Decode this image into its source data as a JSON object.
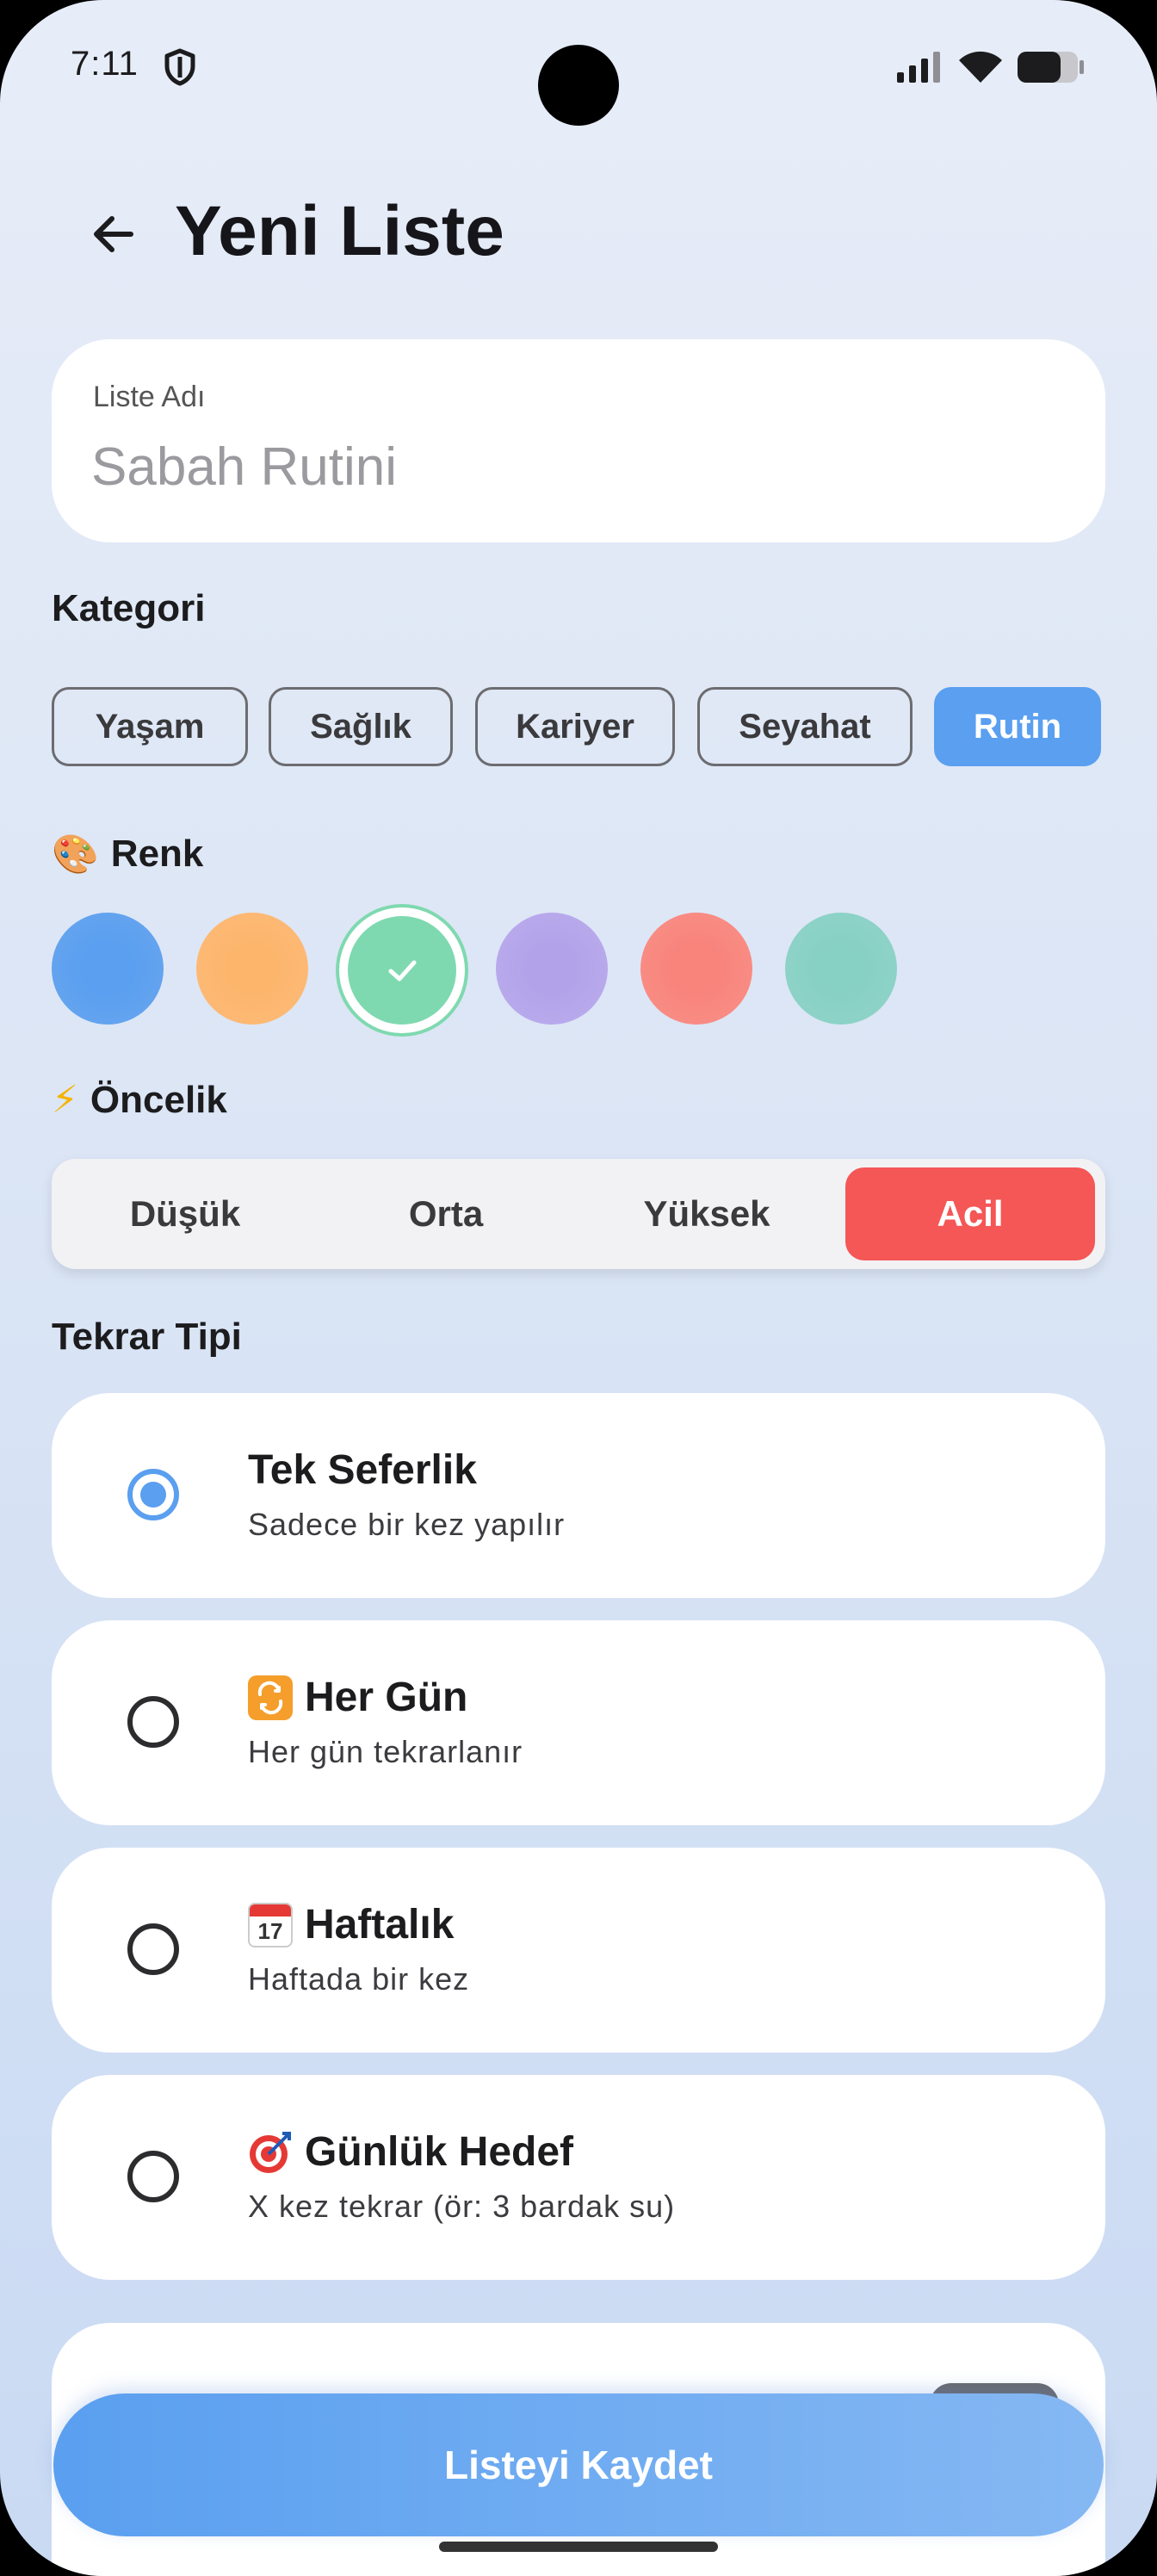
{
  "status_bar": {
    "time": "7:11"
  },
  "header": {
    "title": "Yeni Liste",
    "back_icon": "arrow-left-icon"
  },
  "list_name": {
    "label": "Liste Adı",
    "placeholder": "Sabah Rutini",
    "value": ""
  },
  "category": {
    "title": "Kategori",
    "chips": [
      {
        "label": "Yaşam",
        "selected": false
      },
      {
        "label": "Sağlık",
        "selected": false
      },
      {
        "label": "Kariyer",
        "selected": false
      },
      {
        "label": "Seyahat",
        "selected": false
      },
      {
        "label": "Rutin",
        "selected": true
      }
    ],
    "accent": "#5a9ff0"
  },
  "color": {
    "title": "Renk",
    "icon": "palette-icon",
    "swatches": [
      "#5a9ff0",
      "#fdb56c",
      "#7fd9b0",
      "#b6a6ea",
      "#f8847c",
      "#87d0c4"
    ],
    "selected_index": 2
  },
  "priority": {
    "title": "Öncelik",
    "icon": "lightning-icon",
    "options": [
      "Düşük",
      "Orta",
      "Yüksek",
      "Acil"
    ],
    "selected_index": 3,
    "selected_color": "#f55656"
  },
  "repeat": {
    "title": "Tekrar Tipi",
    "options": [
      {
        "icon": "",
        "title": "Tek Seferlik",
        "subtitle": "Sadece bir kez yapılır",
        "selected": true
      },
      {
        "icon": "repeat-icon",
        "title": "Her Gün",
        "subtitle": "Her gün tekrarlanır",
        "selected": false
      },
      {
        "icon": "calendar-icon",
        "title": "Haftalık",
        "subtitle": "Haftada bir kez",
        "selected": false
      },
      {
        "icon": "target-icon",
        "title": "Günlük Hedef",
        "subtitle": "X kez tekrar (ör: 3 bardak su)",
        "selected": false
      }
    ]
  },
  "save_button": {
    "label": "Listeyi Kaydet"
  }
}
